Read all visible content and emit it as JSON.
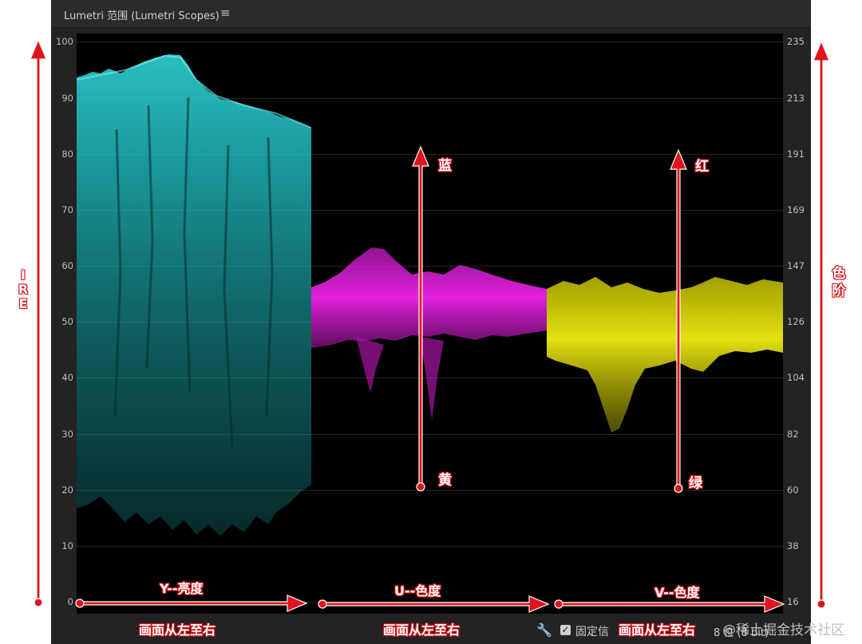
{
  "header": {
    "title": "Lumetri 范围 (Lumetri Scopes)",
    "menu_icon": "hamburger-menu-icon"
  },
  "scale": {
    "left_ticks": [
      "100",
      "90",
      "80",
      "70",
      "60",
      "50",
      "40",
      "30",
      "20",
      "10",
      "0"
    ],
    "right_ticks": [
      "235",
      "213",
      "191",
      "169",
      "147",
      "126",
      "104",
      "82",
      "60",
      "38",
      "16"
    ]
  },
  "waveform_colors": {
    "y": "#22c6c9",
    "u": "#e21de0",
    "v": "#e0dc00"
  },
  "annotations": {
    "ire": [
      "I",
      "R",
      "E"
    ],
    "levels": [
      "色",
      "阶"
    ],
    "blue": "蓝",
    "yellow": "黄",
    "red": "红",
    "green": "绿",
    "y_label": "Y--亮度",
    "u_label": "U--色度",
    "v_label": "V--色度",
    "left_to_right": "画面从左至右"
  },
  "bottom_bar": {
    "wrench_icon": "wrench-icon",
    "lock_checked": true,
    "lock_label": "固定信",
    "bit_depth": "8 位 (8 bit)"
  },
  "watermark": "@稀土掘金技术社区"
}
